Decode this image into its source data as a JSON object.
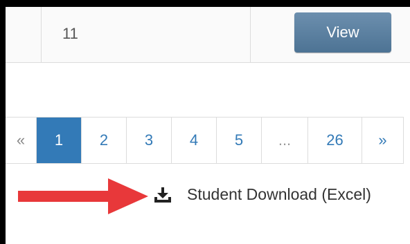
{
  "table": {
    "row": {
      "count": "11",
      "view_label": "View"
    }
  },
  "pagination": {
    "items": [
      {
        "label": "«",
        "type": "prev"
      },
      {
        "label": "1",
        "type": "active"
      },
      {
        "label": "2",
        "type": "num"
      },
      {
        "label": "3",
        "type": "num"
      },
      {
        "label": "4",
        "type": "num"
      },
      {
        "label": "5",
        "type": "num"
      },
      {
        "label": "...",
        "type": "ellipsis"
      },
      {
        "label": "26",
        "type": "last"
      },
      {
        "label": "»",
        "type": "next"
      }
    ]
  },
  "download": {
    "icon": "download-icon",
    "label": "Student Download (Excel)"
  },
  "annotation": {
    "icon": "red-arrow",
    "color": "#e8383a"
  },
  "colors": {
    "accent": "#337ab7",
    "button": "#5a7f9f"
  }
}
